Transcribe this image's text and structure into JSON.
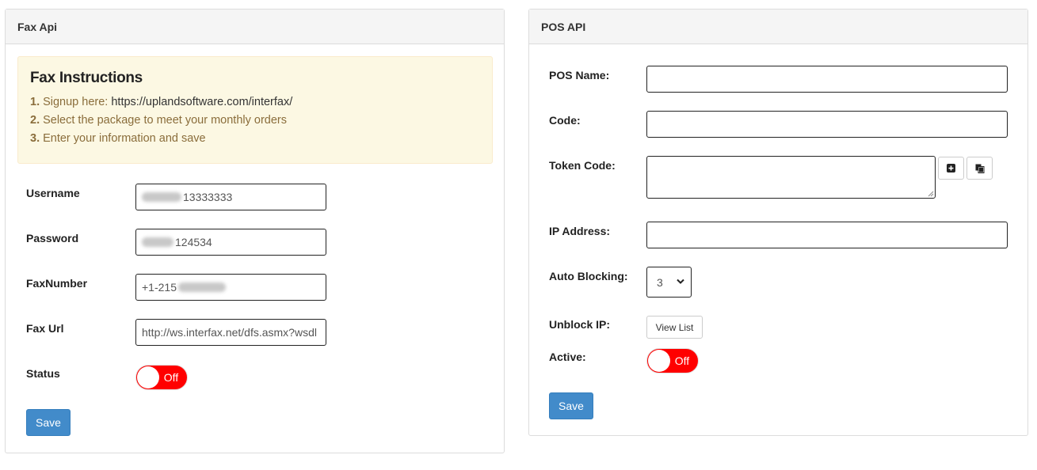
{
  "fax_panel": {
    "title": "Fax Api",
    "instructions": {
      "heading": "Fax Instructions",
      "steps": [
        {
          "num": "1.",
          "text": "Signup here: ",
          "url": "https://uplandsoftware.com/interfax/"
        },
        {
          "num": "2.",
          "text": "Select the package to meet your monthly orders"
        },
        {
          "num": "3.",
          "text": "Enter your information and save"
        }
      ]
    },
    "fields": {
      "username": {
        "label": "Username",
        "value_visible": "13333333"
      },
      "password": {
        "label": "Password",
        "value_visible": "124534"
      },
      "fax_number": {
        "label": "FaxNumber",
        "value_visible": "+1-215"
      },
      "fax_url": {
        "label": "Fax Url",
        "value": "http://ws.interfax.net/dfs.asmx?wsdl"
      },
      "status": {
        "label": "Status",
        "toggle_text": "Off"
      }
    },
    "save_label": "Save"
  },
  "pos_panel": {
    "title": "POS API",
    "fields": {
      "pos_name": {
        "label": "POS Name:",
        "value": ""
      },
      "code": {
        "label": "Code:",
        "value": ""
      },
      "token_code": {
        "label": "Token Code:",
        "value": ""
      },
      "ip_address": {
        "label": "IP Address:",
        "value": ""
      },
      "auto_blocking": {
        "label": "Auto Blocking:",
        "selected": "3"
      },
      "unblock_ip": {
        "label": "Unblock IP:",
        "button": "View List"
      },
      "active": {
        "label": "Active:",
        "toggle_text": "Off"
      }
    },
    "token_buttons": [
      {
        "icon": "plus-square-icon"
      },
      {
        "icon": "copy-icon"
      }
    ],
    "save_label": "Save"
  },
  "colors": {
    "heading_bg": "#f5f5f5",
    "alert_bg": "#fcf8e3",
    "alert_text": "#8a6d3b",
    "toggle_off": "#ff0000",
    "primary": "#428bca"
  }
}
